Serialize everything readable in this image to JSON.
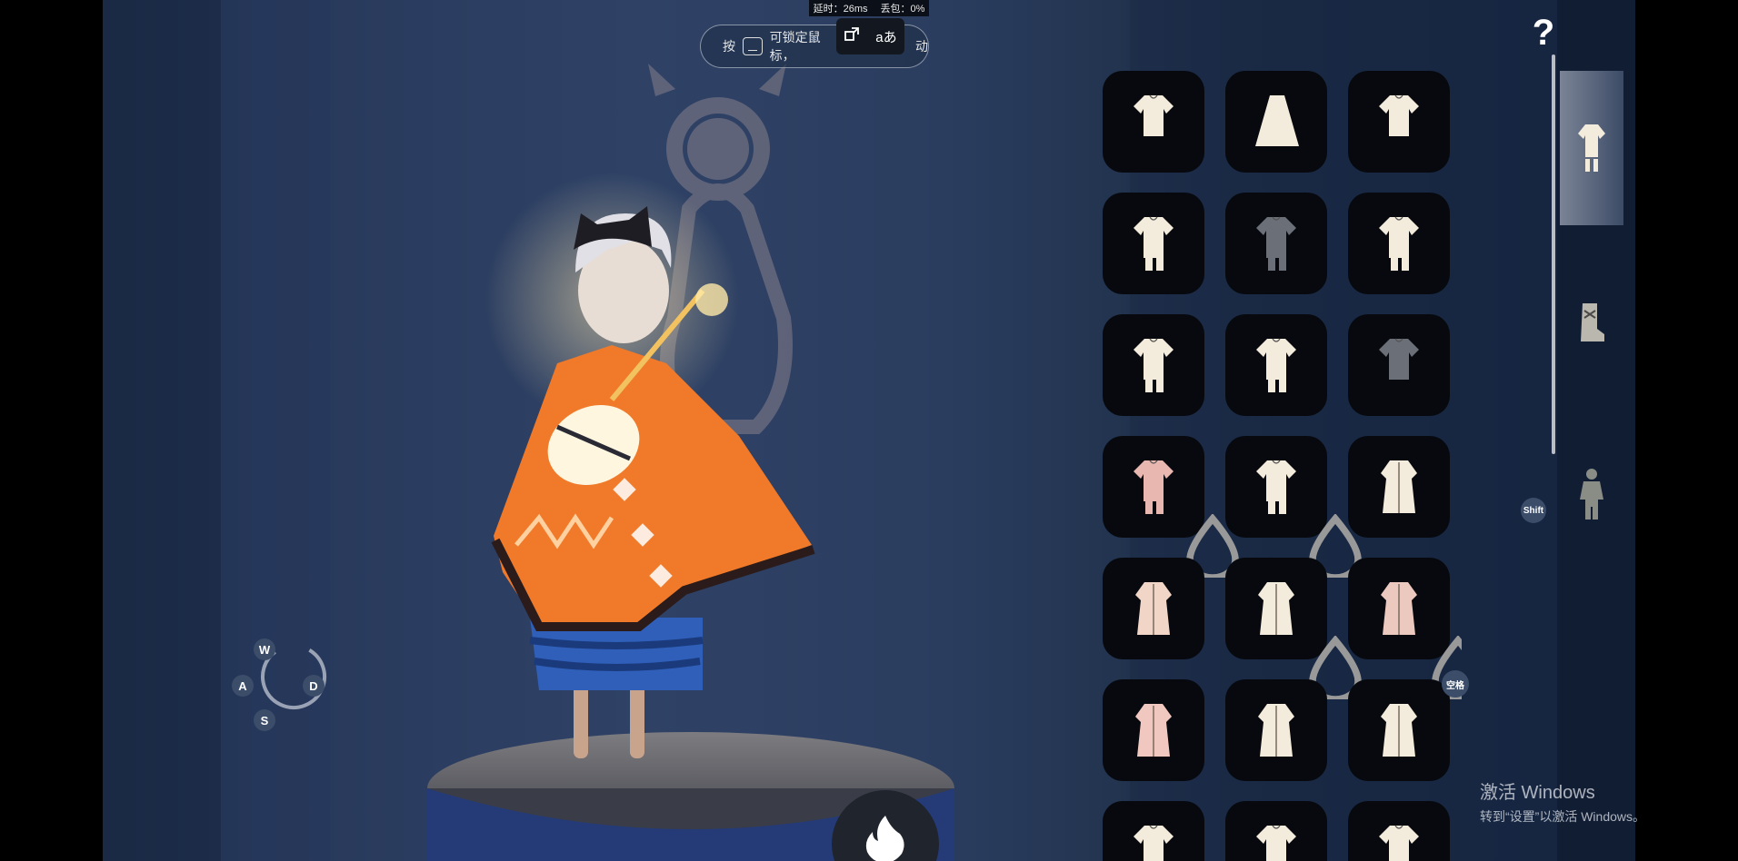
{
  "overlay": {
    "latency": "延时：26ms",
    "packet_loss": "丢包：0%",
    "buttons": [
      "screen-switch-icon",
      "translate-icon"
    ],
    "translate_label": "aあ"
  },
  "hint": {
    "prefix": "按",
    "text": "可锁定鼠标，",
    "tail": "动"
  },
  "top_controls": {
    "help_label": "?",
    "close_icon": "close-icon"
  },
  "closet": {
    "categories": [
      {
        "name": "outfit",
        "icon": "outfit-icon",
        "active": true
      },
      {
        "name": "shoes",
        "icon": "boot-icon",
        "active": false
      },
      {
        "name": "body",
        "icon": "figure-icon",
        "active": false
      }
    ],
    "items": [
      {
        "icon": "robe-icon",
        "variant": "tunic",
        "locked": false,
        "dyeable": false
      },
      {
        "icon": "robe-icon",
        "variant": "dress",
        "locked": false,
        "dyeable": false
      },
      {
        "icon": "robe-icon",
        "variant": "tunic",
        "locked": false,
        "dyeable": false
      },
      {
        "icon": "robe-icon",
        "variant": "shirt-shorts",
        "locked": false,
        "dyeable": false
      },
      {
        "icon": "robe-icon",
        "variant": "hooded-pants",
        "locked": true,
        "dyeable": false
      },
      {
        "icon": "robe-icon",
        "variant": "shirt-shorts",
        "locked": false,
        "dyeable": false
      },
      {
        "icon": "robe-icon",
        "variant": "shirt-shorts",
        "locked": false,
        "dyeable": false
      },
      {
        "icon": "robe-icon",
        "variant": "hooded-pants",
        "locked": false,
        "dyeable": false
      },
      {
        "icon": "robe-icon",
        "variant": "tunic",
        "locked": true,
        "dyeable": false
      },
      {
        "icon": "robe-icon",
        "variant": "buttoned",
        "locked": false,
        "dyeable": true,
        "tint": "#e8b7b0"
      },
      {
        "icon": "robe-icon",
        "variant": "scarf",
        "locked": false,
        "dyeable": true
      },
      {
        "icon": "robe-icon",
        "variant": "long-coat",
        "locked": false,
        "dyeable": false
      },
      {
        "icon": "robe-icon",
        "variant": "kimono",
        "locked": false,
        "dyeable": false,
        "tint": "#f1d6c8"
      },
      {
        "icon": "robe-icon",
        "variant": "cloak",
        "locked": false,
        "dyeable": true
      },
      {
        "icon": "robe-icon",
        "variant": "sash",
        "locked": false,
        "dyeable": true,
        "tint": "#ecc9bf"
      },
      {
        "icon": "robe-icon",
        "variant": "dress-belted",
        "locked": false,
        "dyeable": false,
        "tint": "#f1c8c0"
      },
      {
        "icon": "robe-icon",
        "variant": "wrap",
        "locked": false,
        "dyeable": false
      },
      {
        "icon": "robe-icon",
        "variant": "long-robe",
        "locked": false,
        "dyeable": false
      },
      {
        "icon": "robe-icon",
        "variant": "tunic",
        "locked": false,
        "dyeable": false
      },
      {
        "icon": "robe-icon",
        "variant": "tunic",
        "locked": false,
        "dyeable": false
      },
      {
        "icon": "robe-icon",
        "variant": "tunic",
        "locked": false,
        "dyeable": false
      }
    ]
  },
  "key_badges": {
    "shift": "Shift",
    "space": "空格",
    "w": "W",
    "a": "A",
    "s": "S",
    "d": "D"
  },
  "bottom_action_icon": "flame-icon",
  "watermark": {
    "line1": "激活 Windows",
    "line2": "转到“设置”以激活 Windows。"
  },
  "colors": {
    "cape": "#f07a2a",
    "pants": "#2f5fb8",
    "item": "#f3ebdb",
    "item_locked": "#6b6f78",
    "tile_bg": "#07090e"
  }
}
